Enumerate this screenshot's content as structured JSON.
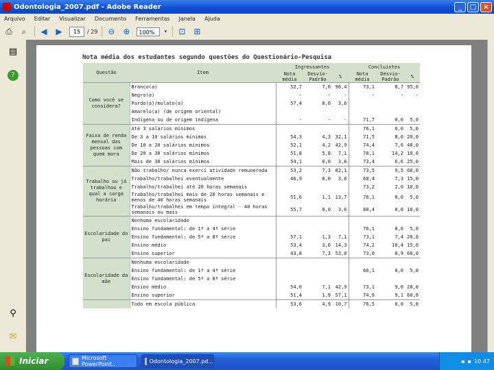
{
  "window": {
    "title": "Odontologia_2007.pdf - Adobe Reader",
    "btn_min": "_",
    "btn_max": "□",
    "btn_close": "×"
  },
  "menu": [
    "Arquivo",
    "Editar",
    "Visualizar",
    "Documento",
    "Ferramentas",
    "Janela",
    "Ajuda"
  ],
  "toolbar": {
    "page_current": "15",
    "page_total": "/ 29",
    "zoom": "100%"
  },
  "document": {
    "title": "Nota média dos estudantes segundo questões do Questionário-Pesquisa",
    "headers": {
      "questao": "Questão",
      "item": "Item",
      "ingressantes": "Ingressantes",
      "concluintes": "Concluintes",
      "nota_media": "Nota média",
      "desvio_padrao": "Desvio-Padrão",
      "pct": "%"
    },
    "groups": [
      {
        "question": "Como você se considera?",
        "rows": [
          {
            "item": "Branco(a)",
            "v": [
              "52,7",
              "7,0",
              "96,4",
              "73,1",
              "8,7",
              "95,0"
            ]
          },
          {
            "item": "Negro(a)",
            "v": [
              "-",
              "-",
              "-",
              "-",
              "-",
              "-"
            ]
          },
          {
            "item": "Pardo(a)/mulato(a)",
            "v": [
              "57,4",
              "0,0",
              "3,6",
              "",
              "",
              ""
            ]
          },
          {
            "item": "Amarelo(a) (de origem oriental)",
            "v": [
              "",
              "",
              "",
              "",
              "",
              ""
            ]
          },
          {
            "item": "Indígena ou de origem indígena",
            "v": [
              "-",
              "-",
              "-",
              "71,7",
              "0,0",
              "5,0"
            ]
          }
        ]
      },
      {
        "question": "Faixa de renda mensal das pessoas com quem mora",
        "rows": [
          {
            "item": "Até 3 salários mínimos",
            "v": [
              "",
              "",
              "",
              "76,1",
              "0,0",
              "5,0"
            ]
          },
          {
            "item": "De 3 a 10 salários mínimos",
            "v": [
              "54,3",
              "4,3",
              "32,1",
              "71,5",
              "8,0",
              "20,0"
            ]
          },
          {
            "item": "De 10 a 20 salários mínimos",
            "v": [
              "52,1",
              "4,2",
              "42,9",
              "74,4",
              "7,6",
              "40,0"
            ]
          },
          {
            "item": "De 20 a 30 salários mínimos",
            "v": [
              "51,8",
              "5,8",
              "7,1",
              "70,1",
              "14,2",
              "10,0"
            ]
          },
          {
            "item": "Mais de 30 salários mínimos",
            "v": [
              "54,1",
              "0,0",
              "3,6",
              "73,4",
              "6,6",
              "25,0"
            ]
          }
        ]
      },
      {
        "question": "Trabalho ou já trabalhou e qual a carga horária",
        "rows": [
          {
            "item": "Não trabalho/ nunca exerci atividade remunerada",
            "v": [
              "53,2",
              "7,3",
              "82,1",
              "73,5",
              "9,5",
              "60,0"
            ]
          },
          {
            "item": "Trabalho/trabalhei eventualmente",
            "v": [
              "46,9",
              "0,0",
              "3,6",
              "68,4",
              "7,3",
              "15,0"
            ]
          },
          {
            "item": "Trabalho/trabalhei até 20 horas semanais",
            "v": [
              "",
              "",
              "",
              "73,2",
              "2,0",
              "10,0"
            ]
          },
          {
            "item": "Trabalho/trabalhei mais de 20 horas semanais e menos de 40 horas semanais",
            "v": [
              "51,6",
              "1,1",
              "13,7",
              "76,1",
              "0,0",
              "5,0"
            ]
          },
          {
            "item": "Trabalho/trabalhei em tempo integral - 40 horas semanais ou mais",
            "v": [
              "55,7",
              "0,0",
              "3,6",
              "80,4",
              "0,0",
              "10,0"
            ]
          }
        ]
      },
      {
        "question": "Escolaridade do pai",
        "rows": [
          {
            "item": "Nenhuma escolaridade",
            "v": [
              "",
              "",
              "",
              "",
              "",
              ""
            ]
          },
          {
            "item": "Ensino fundamental: de 1ª a 4ª série",
            "v": [
              "",
              "",
              "",
              "76,1",
              "0,0",
              "5,0"
            ]
          },
          {
            "item": "Ensino fundamental: de 5ª a 8ª série",
            "v": [
              "57,1",
              "1,3",
              "7,1",
              "73,1",
              "7,4",
              "20,0"
            ]
          },
          {
            "item": "Ensino médio",
            "v": [
              "53,4",
              "3,6",
              "14,3",
              "74,2",
              "10,4",
              "15,0"
            ]
          },
          {
            "item": "Ensino superior",
            "v": [
              "43,8",
              "7,3",
              "53,0",
              "73,0",
              "8,9",
              "60,0"
            ]
          }
        ]
      },
      {
        "question": "Escolaridade da mãe",
        "rows": [
          {
            "item": "Nenhuma escolaridade",
            "v": [
              "",
              "",
              "",
              "",
              "",
              ""
            ]
          },
          {
            "item": "Ensino fundamental: de 1ª a 4ª série",
            "v": [
              "",
              "",
              "",
              "66,1",
              "0,0",
              "5,0"
            ]
          },
          {
            "item": "Ensino fundamental: de 5ª a 8ª série",
            "v": [
              "",
              "",
              "",
              "",
              "",
              ""
            ]
          },
          {
            "item": "Ensino médio",
            "v": [
              "54,0",
              "7,1",
              "42,9",
              "73,1",
              "9,0",
              "20,0"
            ]
          },
          {
            "item": "Ensino superior",
            "v": [
              "51,4",
              "1,9",
              "57,1",
              "74,9",
              "9,1",
              "60,0"
            ]
          }
        ]
      },
      {
        "question": "",
        "rows": [
          {
            "item": "Todo em escola pública",
            "v": [
              "53,6",
              "4,9",
              "10,7",
              "76,5",
              "0,0",
              "5,0"
            ]
          }
        ]
      }
    ]
  },
  "taskbar": {
    "start": "Iniciar",
    "tasks": [
      "Microsoft PowerPoint...",
      "Odontologia_2007.pd..."
    ],
    "clock": "10:47"
  }
}
